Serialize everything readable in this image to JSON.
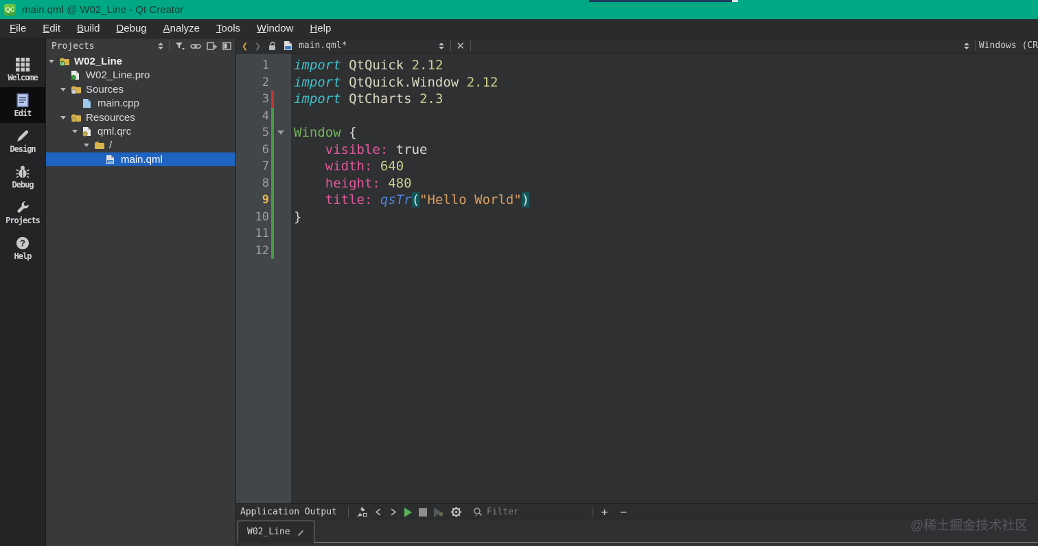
{
  "titlebar": {
    "badge": "QC",
    "title": "main.qml @ W02_Line - Qt Creator"
  },
  "menubar": {
    "items": [
      "File",
      "Edit",
      "Build",
      "Debug",
      "Analyze",
      "Tools",
      "Window",
      "Help"
    ]
  },
  "mode_sidebar": {
    "items": [
      {
        "label": "Welcome",
        "icon": "grid-icon",
        "active": false
      },
      {
        "label": "Edit",
        "icon": "document-icon",
        "active": true
      },
      {
        "label": "Design",
        "icon": "pencil-icon",
        "active": false
      },
      {
        "label": "Debug",
        "icon": "bug-icon",
        "active": false
      },
      {
        "label": "Projects",
        "icon": "wrench-icon",
        "active": false
      },
      {
        "label": "Help",
        "icon": "help-icon",
        "active": false
      }
    ]
  },
  "projects_panel": {
    "header": {
      "title": "Projects",
      "icons": [
        "pane-selector-arrows-icon",
        "filter-icon",
        "link-with-editor-icon",
        "split-icon",
        "close-pane-icon"
      ]
    },
    "tree": [
      {
        "label": "W02_Line",
        "depth": 0,
        "icon": "qt-project-folder-icon",
        "arrow": true,
        "bold": true,
        "selected": false
      },
      {
        "label": "W02_Line.pro",
        "depth": 1,
        "icon": "pro-file-icon",
        "arrow": false,
        "bold": false,
        "selected": false
      },
      {
        "label": "Sources",
        "depth": 1,
        "icon": "sources-folder-icon",
        "arrow": true,
        "bold": false,
        "selected": false
      },
      {
        "label": "main.cpp",
        "depth": 2,
        "icon": "cpp-file-icon",
        "arrow": false,
        "bold": false,
        "selected": false
      },
      {
        "label": "Resources",
        "depth": 1,
        "icon": "resources-folder-icon",
        "arrow": true,
        "bold": false,
        "selected": false
      },
      {
        "label": "qml.qrc",
        "depth": 2,
        "icon": "qrc-file-icon",
        "arrow": true,
        "bold": false,
        "selected": false
      },
      {
        "label": "/",
        "depth": 3,
        "icon": "folder-icon",
        "arrow": true,
        "bold": false,
        "selected": false
      },
      {
        "label": "main.qml",
        "depth": 4,
        "icon": "qml-file-icon",
        "arrow": false,
        "bold": false,
        "selected": true
      }
    ]
  },
  "editor": {
    "navbar": {
      "file_label": "main.qml*"
    },
    "line_endings": "Windows (CR",
    "current_line": 9,
    "fold_line": 5,
    "vcs": {
      "red_line": 3,
      "green_from": 4,
      "green_to": 12
    },
    "lines": [
      {
        "num": 1,
        "tokens": [
          [
            "kw",
            "import"
          ],
          [
            "plain",
            " "
          ],
          [
            "mod",
            "QtQuick"
          ],
          [
            "plain",
            " "
          ],
          [
            "num",
            "2.12"
          ]
        ]
      },
      {
        "num": 2,
        "tokens": [
          [
            "kw",
            "import"
          ],
          [
            "plain",
            " "
          ],
          [
            "mod",
            "QtQuick.Window"
          ],
          [
            "plain",
            " "
          ],
          [
            "num",
            "2.12"
          ]
        ]
      },
      {
        "num": 3,
        "tokens": [
          [
            "kw",
            "import"
          ],
          [
            "plain",
            " "
          ],
          [
            "mod",
            "QtCharts"
          ],
          [
            "plain",
            " "
          ],
          [
            "num",
            "2.3"
          ]
        ]
      },
      {
        "num": 4,
        "tokens": []
      },
      {
        "num": 5,
        "tokens": [
          [
            "type",
            "Window"
          ],
          [
            "plain",
            " {"
          ]
        ]
      },
      {
        "num": 6,
        "tokens": [
          [
            "plain",
            "    "
          ],
          [
            "prop",
            "visible:"
          ],
          [
            "plain",
            " "
          ],
          [
            "val",
            "true"
          ]
        ]
      },
      {
        "num": 7,
        "tokens": [
          [
            "plain",
            "    "
          ],
          [
            "prop",
            "width:"
          ],
          [
            "plain",
            " "
          ],
          [
            "num",
            "640"
          ]
        ]
      },
      {
        "num": 8,
        "tokens": [
          [
            "plain",
            "    "
          ],
          [
            "prop",
            "height:"
          ],
          [
            "plain",
            " "
          ],
          [
            "num",
            "480"
          ]
        ]
      },
      {
        "num": 9,
        "tokens": [
          [
            "plain",
            "    "
          ],
          [
            "prop",
            "title:"
          ],
          [
            "plain",
            " "
          ],
          [
            "fn",
            "qsTr"
          ],
          [
            "pm",
            "("
          ],
          [
            "str",
            "\"Hello World\""
          ],
          [
            "pm",
            ")"
          ]
        ]
      },
      {
        "num": 10,
        "tokens": [
          [
            "plain",
            "}"
          ]
        ]
      },
      {
        "num": 11,
        "tokens": []
      },
      {
        "num": 12,
        "tokens": []
      }
    ]
  },
  "output_pane": {
    "title": "Application Output",
    "filter_placeholder": "Filter",
    "zoom_in_label": "+",
    "zoom_out_label": "−",
    "tab_label": "W02_Line"
  },
  "watermark": "@稀土掘金技术社区",
  "colors": {
    "titlebar_teal": "#00a884",
    "selection_blue": "#1f63c0",
    "current_line_gold": "#e5b84e",
    "vcs_red": "#c23434",
    "vcs_green": "#3f9e3f",
    "play_green": "#58b158"
  }
}
